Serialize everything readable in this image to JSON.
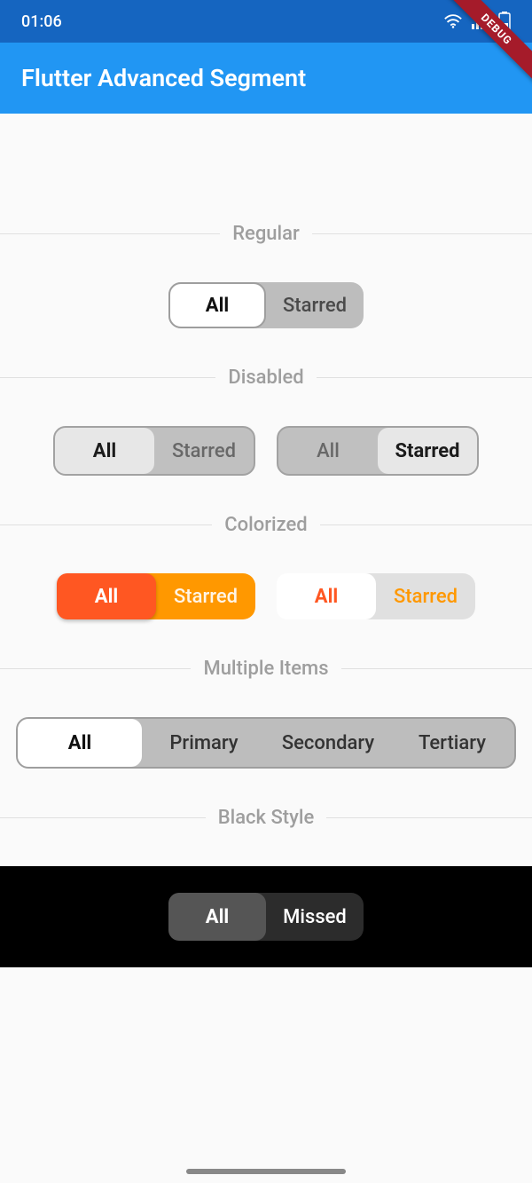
{
  "status": {
    "time": "01:06"
  },
  "debug_label": "DEBUG",
  "app_title": "Flutter Advanced Segment",
  "sections": {
    "regular": {
      "label": "Regular",
      "items": [
        "All",
        "Starred"
      ]
    },
    "disabled": {
      "label": "Disabled",
      "left": {
        "items": [
          "All",
          "Starred"
        ]
      },
      "right": {
        "items": [
          "All",
          "Starred"
        ]
      }
    },
    "colorized": {
      "label": "Colorized",
      "left": {
        "items": [
          "All",
          "Starred"
        ]
      },
      "right": {
        "items": [
          "All",
          "Starred"
        ]
      }
    },
    "multiple": {
      "label": "Multiple Items",
      "items": [
        "All",
        "Primary",
        "Secondary",
        "Tertiary"
      ]
    },
    "black": {
      "label": "Black Style",
      "items": [
        "All",
        "Missed"
      ]
    }
  },
  "colors": {
    "status_bar": "#1565c0",
    "app_bar": "#2196f3",
    "orange_active": "#ff5722",
    "orange_bg": "#ff9800"
  }
}
